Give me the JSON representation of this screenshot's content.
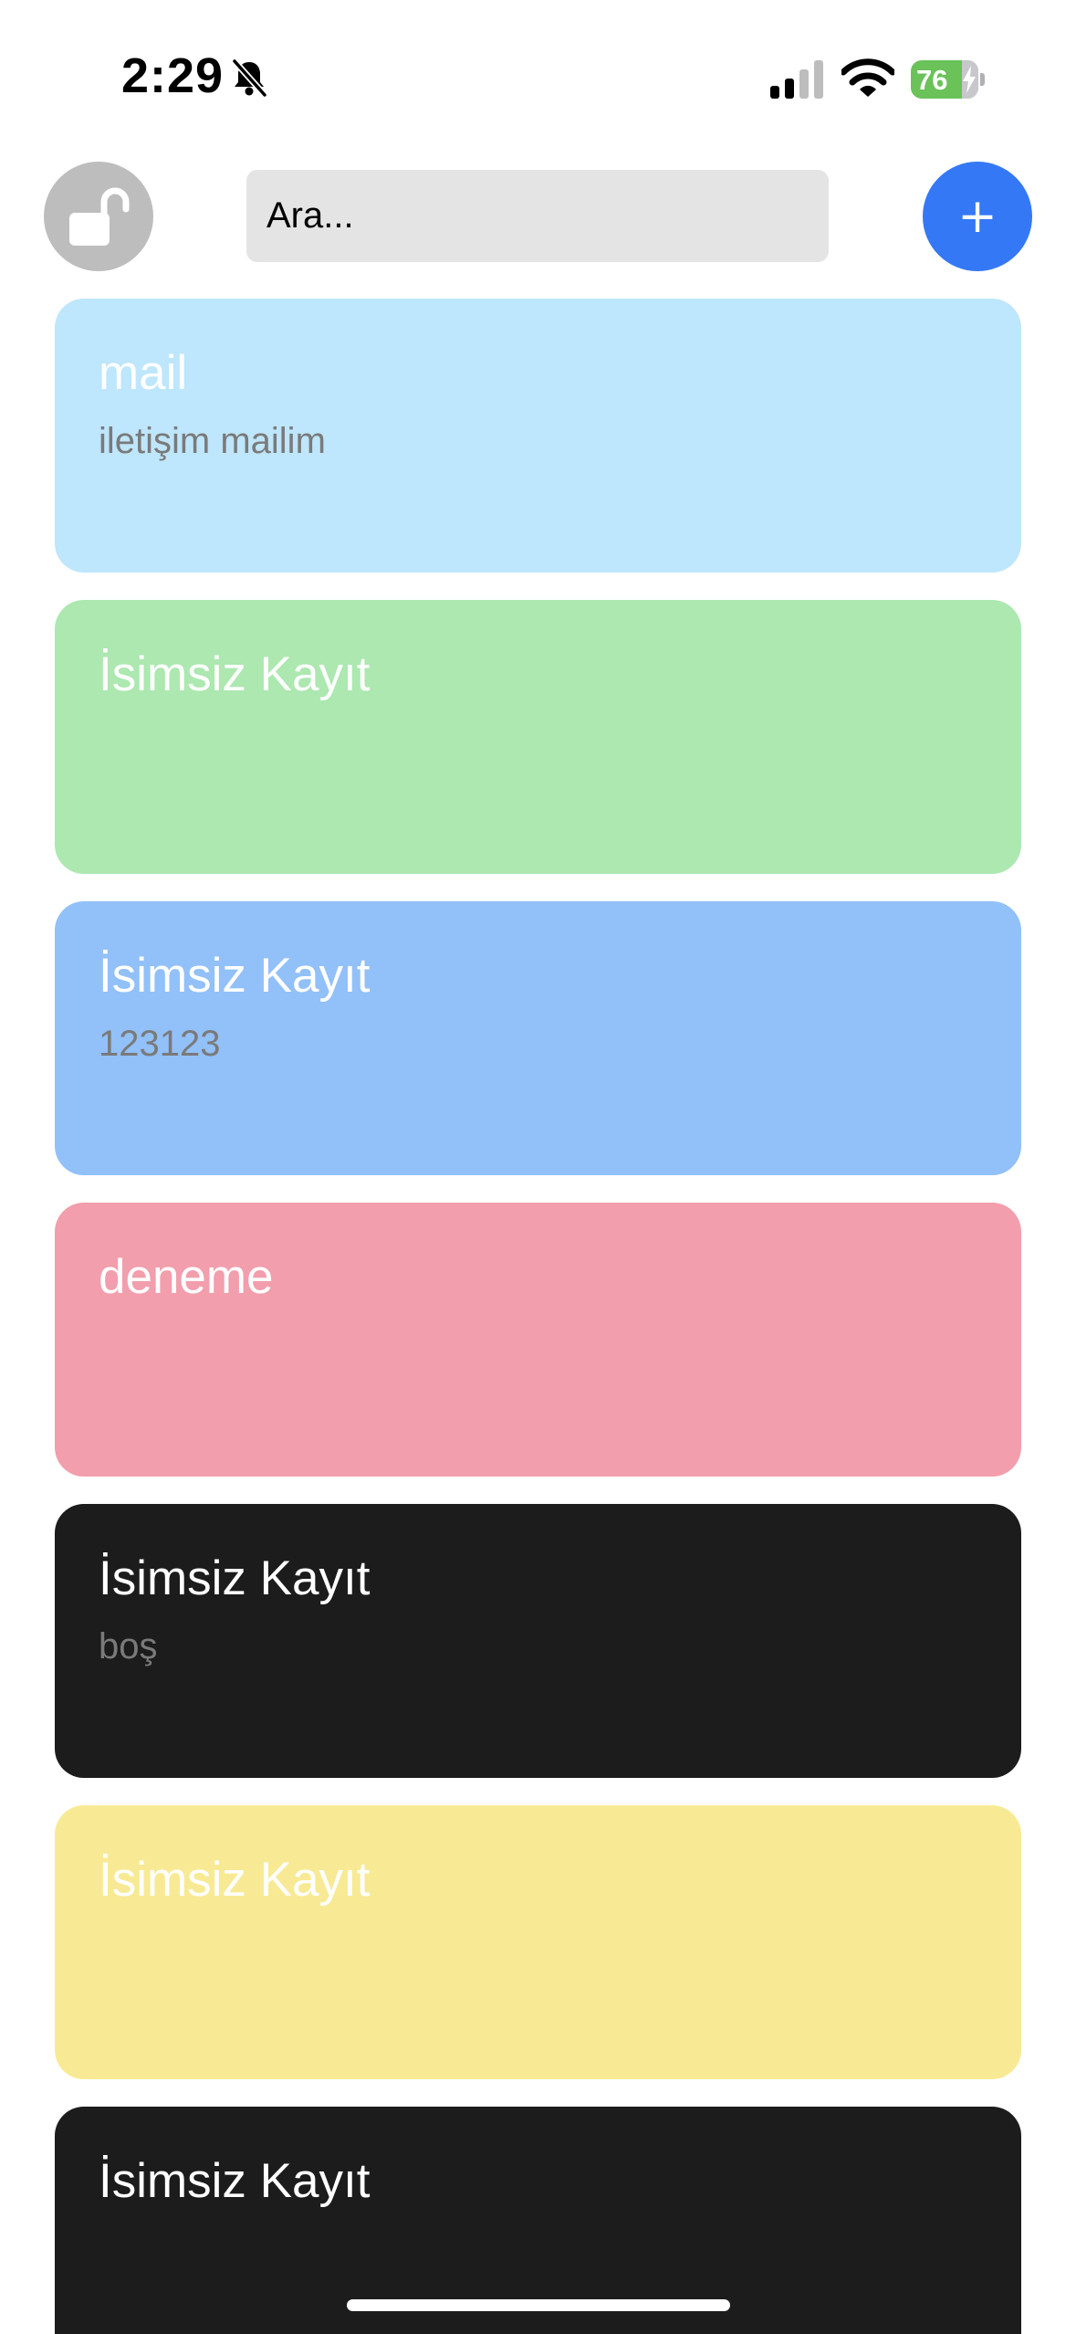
{
  "status_bar": {
    "time": "2:29",
    "battery_level": "76",
    "battery_fraction": 0.76,
    "icons": [
      "bell-slash-icon",
      "cellular-signal-icon",
      "wifi-icon",
      "battery-charging-icon"
    ]
  },
  "header": {
    "lock_icon": "unlocked-padlock-icon",
    "search_placeholder": "Ara...",
    "add_label": "+"
  },
  "notes": [
    {
      "title": "mail",
      "body": "iletişim mailim",
      "color": "#bee6fc"
    },
    {
      "title": "İsimsiz Kayıt",
      "body": "",
      "color": "#ace8b0"
    },
    {
      "title": "İsimsiz Kayıt",
      "body": "123123",
      "color": "#92c0f9"
    },
    {
      "title": "deneme",
      "body": "",
      "color": "#f29eac"
    },
    {
      "title": "İsimsiz Kayıt",
      "body": "boş",
      "color": "#1c1c1c"
    },
    {
      "title": "İsimsiz Kayıt",
      "body": "",
      "color": "#f8ea95"
    },
    {
      "title": "İsimsiz Kayıt",
      "body": "",
      "color": "#1c1c1c"
    }
  ],
  "colors": {
    "accent": "#3478f6",
    "lock_button": "#bdbdbd",
    "search_background": "#e4e4e4",
    "battery": "#6ac259"
  }
}
